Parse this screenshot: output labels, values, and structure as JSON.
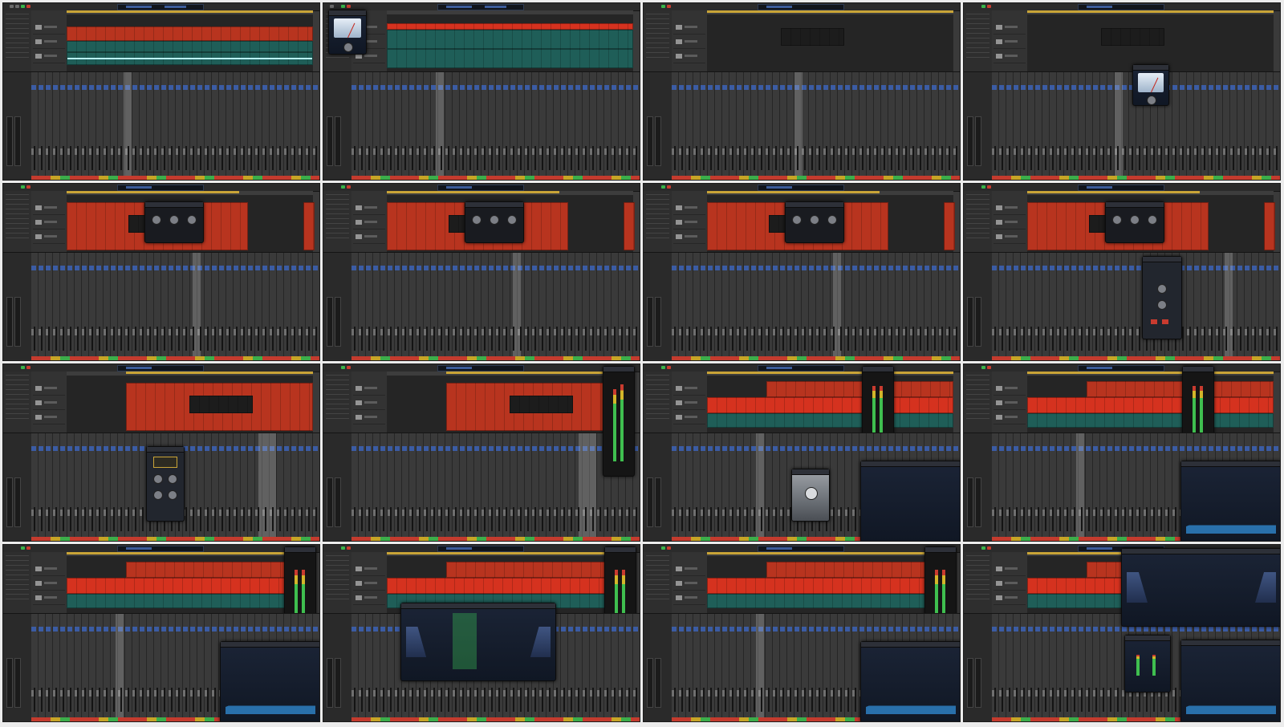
{
  "sheet": {
    "columns": 4,
    "rows": 4,
    "frames": [
      {
        "id": 1,
        "arrangement": "red-tracks",
        "plugin": "none"
      },
      {
        "id": 2,
        "arrangement": "teal-tracks",
        "plugin": "vu-meter-window"
      },
      {
        "id": 3,
        "arrangement": "empty-tracks",
        "plugin": "none"
      },
      {
        "id": 4,
        "arrangement": "empty-tracks",
        "plugin": "vu-meter-window"
      },
      {
        "id": 5,
        "arrangement": "red-block",
        "plugin": "compressor-window"
      },
      {
        "id": 6,
        "arrangement": "red-block",
        "plugin": "compressor-window"
      },
      {
        "id": 7,
        "arrangement": "red-block",
        "plugin": "compressor-window"
      },
      {
        "id": 8,
        "arrangement": "red-block",
        "plugin": "channel-strip-window"
      },
      {
        "id": 9,
        "arrangement": "red-with-gap",
        "plugin": "vintage-eq-window"
      },
      {
        "id": 10,
        "arrangement": "red-with-gap",
        "plugin": "level-meter-window"
      },
      {
        "id": 11,
        "arrangement": "bright-red-bands",
        "plugin": "meter-silver-analyzer"
      },
      {
        "id": 12,
        "arrangement": "bright-red-bands",
        "plugin": "meter-spectrum"
      },
      {
        "id": 13,
        "arrangement": "bright-red-bands",
        "plugin": "meter-spectrum"
      },
      {
        "id": 14,
        "arrangement": "bright-red-bands",
        "plugin": "eq-window-meter"
      },
      {
        "id": 15,
        "arrangement": "bright-red-bands",
        "plugin": "meter-spectrum"
      },
      {
        "id": 16,
        "arrangement": "bright-red-bands",
        "plugin": "eq-spectrum-stack"
      }
    ]
  },
  "colors": {
    "region_red": "#b8341f",
    "region_bright_red": "#d5321f",
    "region_teal": "#1f5e58",
    "background": "#3a3a3a",
    "accent_blue": "#3b67c7"
  }
}
